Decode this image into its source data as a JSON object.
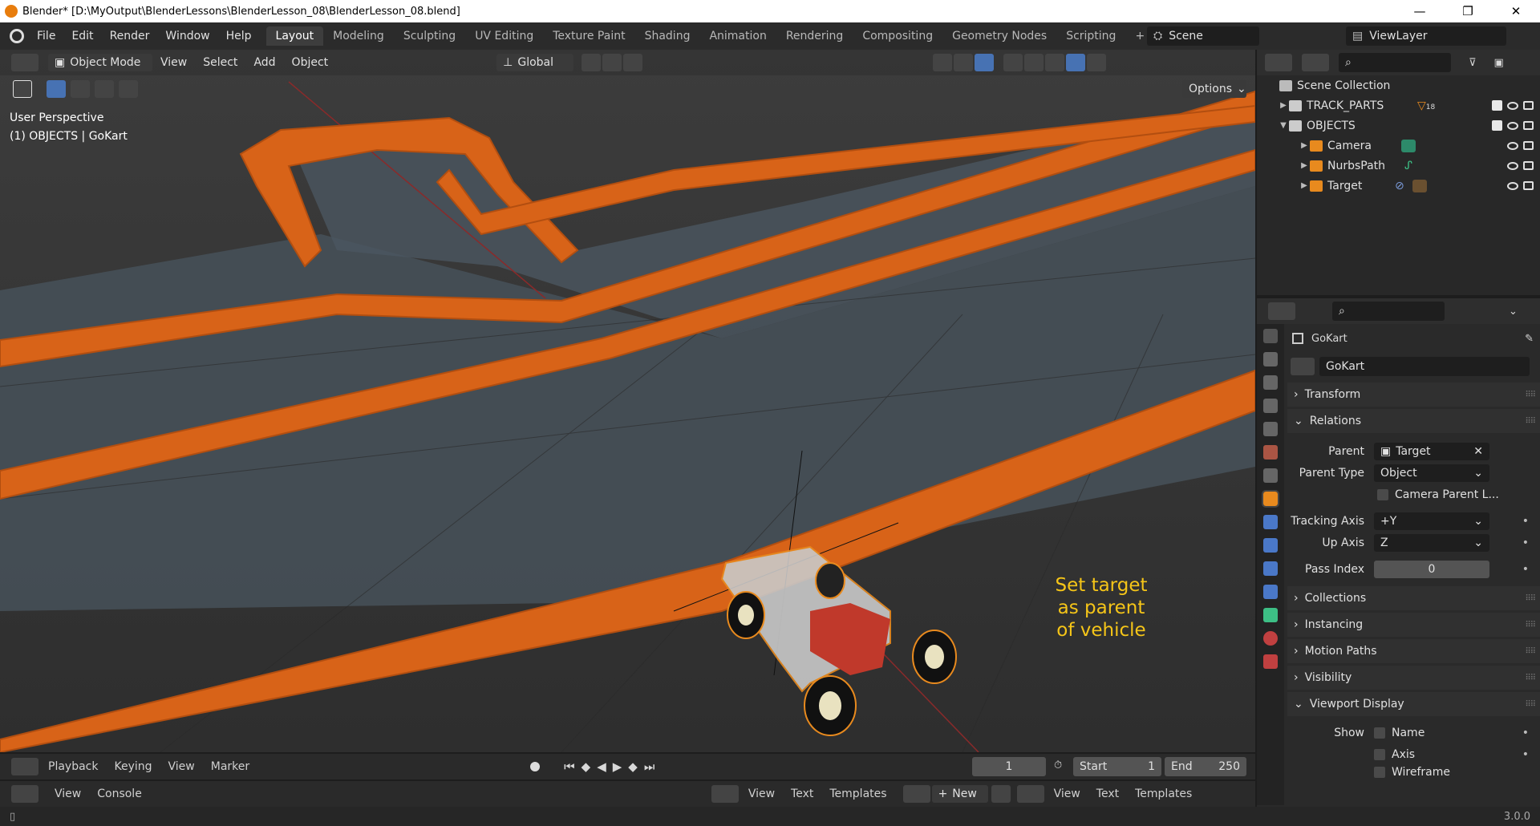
{
  "window": {
    "title": "Blender* [D:\\MyOutput\\BlenderLessons\\BlenderLesson_08\\BlenderLesson_08.blend]",
    "min": "—",
    "max": "❐",
    "close": "✕"
  },
  "menu": [
    "File",
    "Edit",
    "Render",
    "Window",
    "Help"
  ],
  "workspaces": [
    {
      "label": "Layout",
      "active": true
    },
    {
      "label": "Modeling"
    },
    {
      "label": "Sculpting"
    },
    {
      "label": "UV Editing"
    },
    {
      "label": "Texture Paint"
    },
    {
      "label": "Shading"
    },
    {
      "label": "Animation"
    },
    {
      "label": "Rendering"
    },
    {
      "label": "Compositing"
    },
    {
      "label": "Geometry Nodes"
    },
    {
      "label": "Scripting"
    }
  ],
  "add_workspace": "+",
  "scene": "Scene",
  "view_layer": "ViewLayer",
  "viewport": {
    "mode": "Object Mode",
    "menus": [
      "View",
      "Select",
      "Add",
      "Object"
    ],
    "orientation": "Global",
    "options": "Options",
    "perspective": "User Perspective",
    "object_info": "(1) OBJECTS | GoKart",
    "annotation": [
      "Set target",
      "as parent",
      "of vehicle"
    ]
  },
  "timeline": {
    "menus": [
      "Playback",
      "Keying",
      "View",
      "Marker"
    ],
    "current_frame": "1",
    "start_label": "Start",
    "start": "1",
    "end_label": "End",
    "end": "250"
  },
  "bottom": {
    "left_menus": [
      "View",
      "Console"
    ],
    "text1_menus": [
      "View",
      "Text",
      "Templates"
    ],
    "new_label": "New",
    "text2_menus": [
      "View",
      "Text",
      "Templates"
    ]
  },
  "status": {
    "version": "3.0.0"
  },
  "outliner": {
    "root": "Scene Collection",
    "rows": [
      {
        "label": "TRACK_PARTS",
        "indent": 1,
        "expanded": false,
        "badge": "18"
      },
      {
        "label": "OBJECTS",
        "indent": 1,
        "expanded": true
      },
      {
        "label": "Camera",
        "indent": 2,
        "expanded": false
      },
      {
        "label": "NurbsPath",
        "indent": 2,
        "expanded": false
      },
      {
        "label": "Target",
        "indent": 2,
        "expanded": false
      }
    ]
  },
  "properties": {
    "object_name": "GoKart",
    "datablock": "GoKart",
    "sections": {
      "transform": "Transform",
      "relations": "Relations",
      "collections": "Collections",
      "instancing": "Instancing",
      "motion_paths": "Motion Paths",
      "visibility": "Visibility",
      "viewport_display": "Viewport Display"
    },
    "relations": {
      "parent_label": "Parent",
      "parent": "Target",
      "parent_type_label": "Parent Type",
      "parent_type": "Object",
      "camera_parent": "Camera Parent L...",
      "tracking_axis_label": "Tracking Axis",
      "tracking_axis": "+Y",
      "up_axis_label": "Up Axis",
      "up_axis": "Z",
      "pass_index_label": "Pass Index",
      "pass_index": "0"
    },
    "viewport_display": {
      "show_label": "Show",
      "name": "Name",
      "axis": "Axis",
      "wireframe": "Wireframe"
    }
  },
  "colors": {
    "track": "#d86318",
    "accent": "#4772b3",
    "annotation": "#f5c518"
  }
}
